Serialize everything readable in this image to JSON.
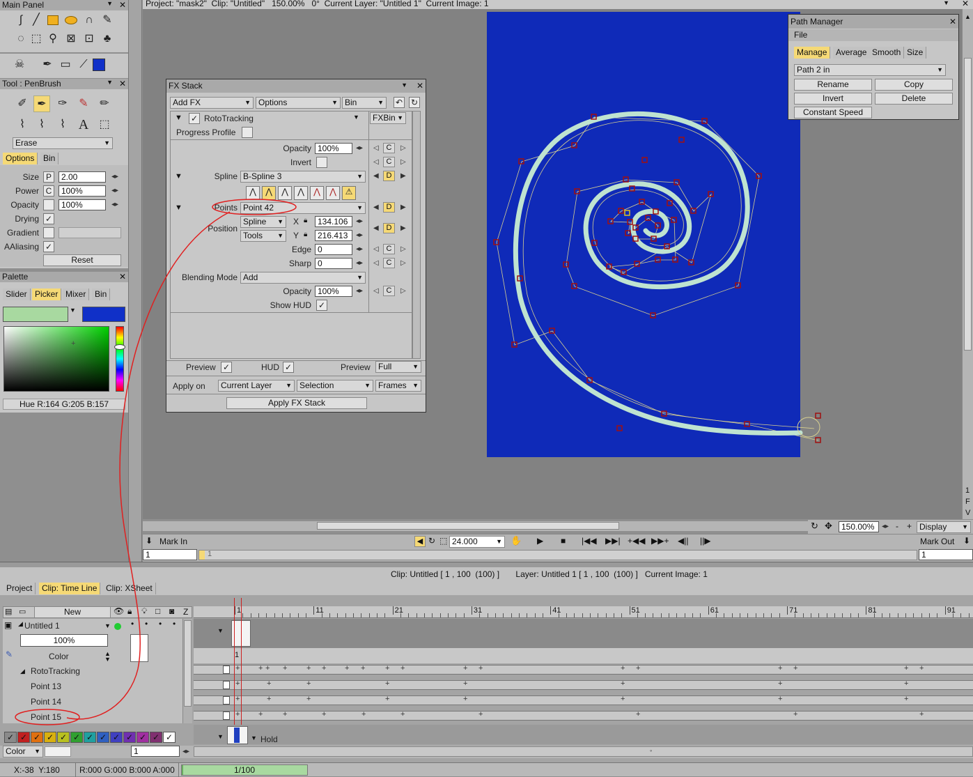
{
  "main_panel": {
    "title": "Main Panel"
  },
  "tool_panel": {
    "title": "Tool : PenBrush",
    "mode": "Erase",
    "tabs": [
      "Options",
      "Bin"
    ],
    "rows": [
      {
        "label": "Size",
        "prefix": "P",
        "value": "2.00"
      },
      {
        "label": "Power",
        "prefix": "C",
        "value": "100%"
      },
      {
        "label": "Opacity",
        "prefix": "",
        "value": "100%"
      }
    ],
    "drying_label": "Drying",
    "gradient_label": "Gradient",
    "aaliasing_label": "AAliasing",
    "reset_label": "Reset"
  },
  "palette": {
    "title": "Palette",
    "tabs": [
      "Slider",
      "Picker",
      "Mixer",
      "Bin"
    ],
    "primary_color": "#a8d9a0",
    "secondary_color": "#1030c8",
    "readout": "Hue R:164 G:205 B:157"
  },
  "viewer": {
    "header": "Project: \"mask2\"  Clip: \"Untitled\"   150.00%   0°  Current Layer: \"Untitled 1\"  Current Image: 1",
    "canvas_color": "#0f2ab8",
    "zoom": "150.00%",
    "display_label": "Display",
    "side_letters": [
      "1",
      "F",
      "V"
    ]
  },
  "fx_stack": {
    "title": "FX Stack",
    "add_fx": "Add FX",
    "options": "Options",
    "bin": "Bin",
    "effect_name": "RotoTracking",
    "fxbin": "FXBin",
    "progress_profile": "Progress Profile",
    "opacity_label": "Opacity",
    "opacity_value": "100%",
    "invert_label": "Invert",
    "spline_label": "Spline",
    "spline_value": "B-Spline 3",
    "points_label": "Points",
    "points_value": "Point 42",
    "position_label": "Position",
    "pos_mode1": "Spline",
    "pos_mode2": "Tools",
    "x_label": "X",
    "x_value": "134.106",
    "y_label": "Y",
    "y_value": "216.413",
    "edge_label": "Edge",
    "edge_value": "0",
    "sharp_label": "Sharp",
    "sharp_value": "0",
    "blending_label": "Blending Mode",
    "blending_value": "Add",
    "opacity2_label": "Opacity",
    "opacity2_value": "100%",
    "show_hud_label": "Show HUD",
    "preview_label": "Preview",
    "hud_label": "HUD",
    "preview2_label": "Preview",
    "preview2_value": "Full",
    "apply_on_label": "Apply on",
    "apply_on_value": "Current Layer",
    "selection_value": "Selection",
    "frames_value": "Frames",
    "apply_btn": "Apply FX Stack",
    "key_c": "C",
    "key_d": "D"
  },
  "path_manager": {
    "title": "Path Manager",
    "menu": "File",
    "tabs": [
      "Manage",
      "Average",
      "Smooth",
      "Size"
    ],
    "path_select": "Path 2 in",
    "buttons": [
      "Rename",
      "Copy",
      "Invert",
      "Delete",
      "Constant Speed"
    ]
  },
  "transport": {
    "mark_in": "Mark In",
    "mark_out": "Mark Out",
    "fps": "24.000",
    "start_frame": "1",
    "end_frame": "1",
    "current_marker": "1"
  },
  "status_line": {
    "clip_info": "Clip: Untitled [ 1 , 100  (100) ]       Layer: Untitled 1 [ 1 , 100  (100) ]   Current Image: 1"
  },
  "timeline": {
    "tabs": [
      "Project",
      "Clip: Time Line",
      "Clip: XSheet"
    ],
    "new_label": "New",
    "z_label": "Z",
    "ruler": [
      "1",
      "11",
      "21",
      "31",
      "41",
      "51",
      "61",
      "71",
      "81",
      "91"
    ],
    "layer_name": "Untitled 1",
    "layer_opacity": "100%",
    "color_label": "Color",
    "fx_name": "RotoTracking",
    "points": [
      "Point 13",
      "Point 14",
      "Point 15"
    ],
    "frame_marker": "1",
    "hold_label": "Hold",
    "bottom_color_label": "Color",
    "bottom_frame": "1"
  },
  "status_bar": {
    "coords": "X:-38  Y:180",
    "rgba": "R:000 G:000 B:000 A:000",
    "progress": "1/100",
    "progress_fraction": 0.01
  }
}
